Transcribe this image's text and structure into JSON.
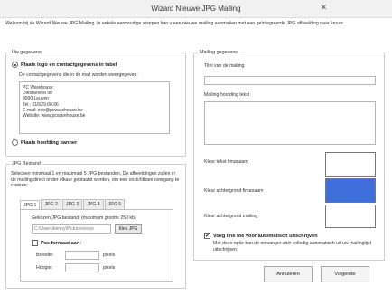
{
  "window": {
    "title": "Wizard Nieuwe JPG Mailing",
    "close_glyph": "✕"
  },
  "intro": "Welkom bij de Wizard Nieuwe JPG Mailing.  In enkele eenvoudige stappen kan u een nieuwe mailing aanmaken met een geïntegreerde JPG afbeelding naar keuze.",
  "uw_gegevens": {
    "label": "Uw gegevens",
    "option_logo": "Plaats logo en contactgegevens in tabel",
    "contact_hint": "De contactgegevens die in de mail worden weergegeven:",
    "contact_lines": [
      "PC Warehouse",
      "Diestsevest 90",
      "3000 Leuven",
      "Tel.: 016/29.60.66",
      "E-mail: info@pcwarehouse.be",
      "Website: www.pcwarehouse.be"
    ],
    "option_banner": "Plaats hoofding banner"
  },
  "jpg_bestand": {
    "label": "JPG Bestand",
    "description": "Selecteer minimaal 1 en maximaal 5 JPG bestanden.  De afbeeldingen zullen in de mailing direct onder elkaar geplaatst worden, om een onzichtbare overgang te creëren.",
    "tabs": [
      "JPG 1",
      "JPG 2",
      "JPG 3",
      "JPG 4",
      "JPG 5"
    ],
    "file_label": "Gekozen JPG bestand:  (maximum grootte 250 kb)",
    "file_path": "C:\\Users\\benny\\Pictures\\exce",
    "browse_button": "Kies JPG",
    "resize_label": "Pas formaat aan:",
    "width_label": "Breedte:",
    "height_label": "Hoogte:",
    "unit": "pixels"
  },
  "mailing": {
    "label": "Mailing gegevens",
    "title_label": "Titel van de mailing",
    "header_label": "Mailing hoofding tekst",
    "text_color_label": "Kleur tekst fimanaam",
    "bg_color_label": "Kleur achtergrond fimanaam",
    "mailing_bg_label": "Kleur achtergrond mailing",
    "unsubscribe_label": "Voeg link toe voor automatisch uitschrijven",
    "unsubscribe_hint": "Met deze optie kan de ontvanger zich volledig automatisch uit uw mailinglijst uitschrijven."
  },
  "colors": {
    "text_color": "#ffffff",
    "bg_color": "#3e6fdc",
    "mailing_bg": "#ffffff"
  },
  "buttons": {
    "cancel": "Annuleren",
    "next": "Volgende"
  }
}
